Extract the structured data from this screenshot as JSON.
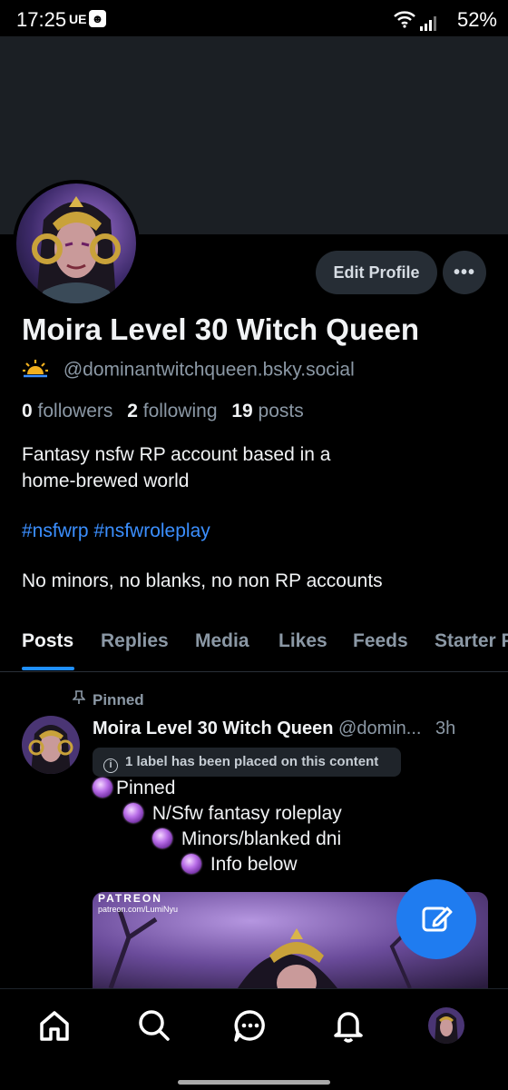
{
  "status_bar": {
    "time": "17:25",
    "carrier": "UE",
    "battery": "52%"
  },
  "profile": {
    "display_name": "Moira Level 30 Witch Queen",
    "handle": "@dominantwitchqueen.bsky.social",
    "edit_label": "Edit Profile",
    "more_label": "•••",
    "followers_count": "0",
    "followers_label": "followers",
    "following_count": "2",
    "following_label": "following",
    "posts_count": "19",
    "posts_label": "posts",
    "bio_line1": "Fantasy nsfw RP account based in a",
    "bio_line2": "home-brewed world",
    "hashtags": "#nsfwrp #nsfwroleplay",
    "rules": "No minors, no blanks, no non RP accounts"
  },
  "tabs": [
    {
      "label": "Posts",
      "active": true
    },
    {
      "label": "Replies",
      "active": false
    },
    {
      "label": "Media",
      "active": false
    },
    {
      "label": "Likes",
      "active": false
    },
    {
      "label": "Feeds",
      "active": false
    },
    {
      "label": "Starter Packs",
      "active": false
    }
  ],
  "post": {
    "pinned_label": "Pinned",
    "author_name": "Moira Level 30 Witch Queen",
    "author_handle": "@domin...",
    "time": "3h",
    "content_label": "1 label has been placed on this content",
    "lines": [
      "Pinned",
      "N/Sfw fantasy roleplay",
      "Minors/blanked dni",
      "Info below"
    ],
    "image_watermark": "PATREON",
    "image_watermark_sub": "patreon.com/LumiNyu"
  },
  "colors": {
    "accent": "#1f8fff",
    "link": "#3b8fff",
    "fab": "#1f7cf0",
    "muted": "#8b98a5",
    "button_bg": "#262d35",
    "banner": "#1b1f24"
  },
  "icons": {
    "status_sun": "sunrise-icon",
    "nav": [
      "home-icon",
      "search-icon",
      "chat-icon",
      "bell-icon",
      "profile-avatar"
    ],
    "fab": "compose-icon"
  }
}
